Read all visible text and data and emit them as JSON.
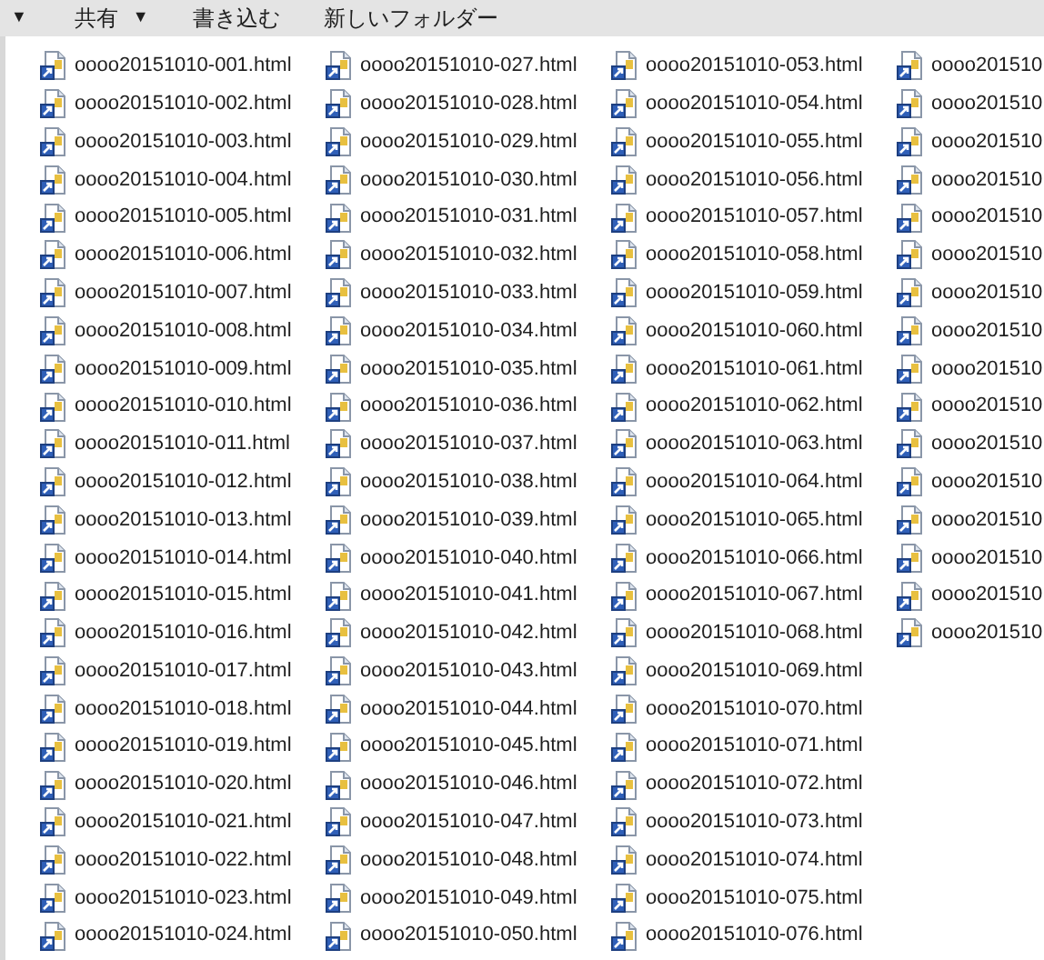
{
  "toolbar": [
    {
      "label": "▼"
    },
    {
      "label": "共有",
      "arrow": "▼"
    },
    {
      "label": "書き込む"
    },
    {
      "label": "新しいフォルダー"
    }
  ],
  "columns": [
    [
      "oooo20151010-001.html",
      "oooo20151010-002.html",
      "oooo20151010-003.html",
      "oooo20151010-004.html",
      "oooo20151010-005.html",
      "oooo20151010-006.html",
      "oooo20151010-007.html",
      "oooo20151010-008.html",
      "oooo20151010-009.html",
      "oooo20151010-010.html",
      "oooo20151010-011.html",
      "oooo20151010-012.html",
      "oooo20151010-013.html",
      "oooo20151010-014.html",
      "oooo20151010-015.html",
      "oooo20151010-016.html",
      "oooo20151010-017.html",
      "oooo20151010-018.html",
      "oooo20151010-019.html",
      "oooo20151010-020.html",
      "oooo20151010-021.html",
      "oooo20151010-022.html",
      "oooo20151010-023.html",
      "oooo20151010-024.html"
    ],
    [
      "oooo20151010-027.html",
      "oooo20151010-028.html",
      "oooo20151010-029.html",
      "oooo20151010-030.html",
      "oooo20151010-031.html",
      "oooo20151010-032.html",
      "oooo20151010-033.html",
      "oooo20151010-034.html",
      "oooo20151010-035.html",
      "oooo20151010-036.html",
      "oooo20151010-037.html",
      "oooo20151010-038.html",
      "oooo20151010-039.html",
      "oooo20151010-040.html",
      "oooo20151010-041.html",
      "oooo20151010-042.html",
      "oooo20151010-043.html",
      "oooo20151010-044.html",
      "oooo20151010-045.html",
      "oooo20151010-046.html",
      "oooo20151010-047.html",
      "oooo20151010-048.html",
      "oooo20151010-049.html",
      "oooo20151010-050.html"
    ],
    [
      "oooo20151010-053.html",
      "oooo20151010-054.html",
      "oooo20151010-055.html",
      "oooo20151010-056.html",
      "oooo20151010-057.html",
      "oooo20151010-058.html",
      "oooo20151010-059.html",
      "oooo20151010-060.html",
      "oooo20151010-061.html",
      "oooo20151010-062.html",
      "oooo20151010-063.html",
      "oooo20151010-064.html",
      "oooo20151010-065.html",
      "oooo20151010-066.html",
      "oooo20151010-067.html",
      "oooo20151010-068.html",
      "oooo20151010-069.html",
      "oooo20151010-070.html",
      "oooo20151010-071.html",
      "oooo20151010-072.html",
      "oooo20151010-073.html",
      "oooo20151010-074.html",
      "oooo20151010-075.html",
      "oooo20151010-076.html"
    ],
    [
      "oooo201510",
      "oooo201510",
      "oooo201510",
      "oooo201510",
      "oooo201510",
      "oooo201510",
      "oooo201510",
      "oooo201510",
      "oooo201510",
      "oooo201510",
      "oooo201510",
      "oooo201510",
      "oooo201510",
      "oooo201510",
      "oooo201510",
      "oooo201510"
    ]
  ]
}
